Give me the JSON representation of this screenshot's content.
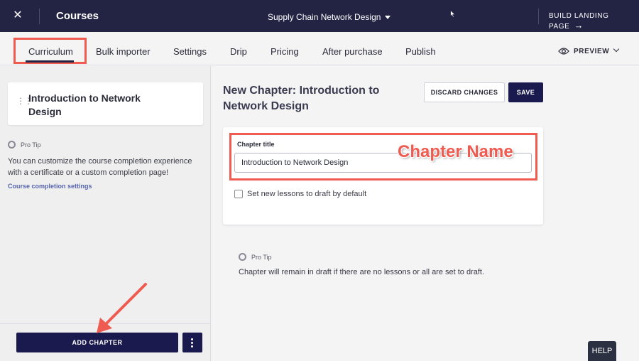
{
  "topbar": {
    "title": "Courses",
    "course_name": "Supply Chain Network Design",
    "build_landing": "BUILD LANDING PAGE",
    "build_arrow": "→",
    "close_glyph": "✕"
  },
  "tabs": [
    {
      "label": "Curriculum",
      "active": true
    },
    {
      "label": "Bulk importer"
    },
    {
      "label": "Settings"
    },
    {
      "label": "Drip"
    },
    {
      "label": "Pricing"
    },
    {
      "label": "After purchase"
    },
    {
      "label": "Publish"
    }
  ],
  "preview_label": "PREVIEW",
  "sidebar": {
    "chapter_name": "Introduction to Network Design",
    "pro_tip_label": "Pro Tip",
    "pro_tip_text": "You can customize the course completion experience with a certificate or a custom completion page!",
    "completion_link": "Course completion settings",
    "add_chapter": "ADD CHAPTER"
  },
  "main": {
    "title": "New Chapter: Introduction to Network Design",
    "discard_label": "DISCARD CHANGES",
    "save_label": "SAVE",
    "field_label": "Chapter title",
    "field_value": "Introduction to Network Design",
    "checkbox_label": "Set new lessons to draft by default",
    "pro_tip_label": "Pro Tip",
    "pro_tip_text": "Chapter will remain in draft if there are no lessons or all are set to draft."
  },
  "annotation": "Chapter Name",
  "help_label": "HELP",
  "colors": {
    "topbar": "#232344",
    "primary_button": "#1a1a4e",
    "highlight": "#ef5b50",
    "link": "#5664b0"
  }
}
